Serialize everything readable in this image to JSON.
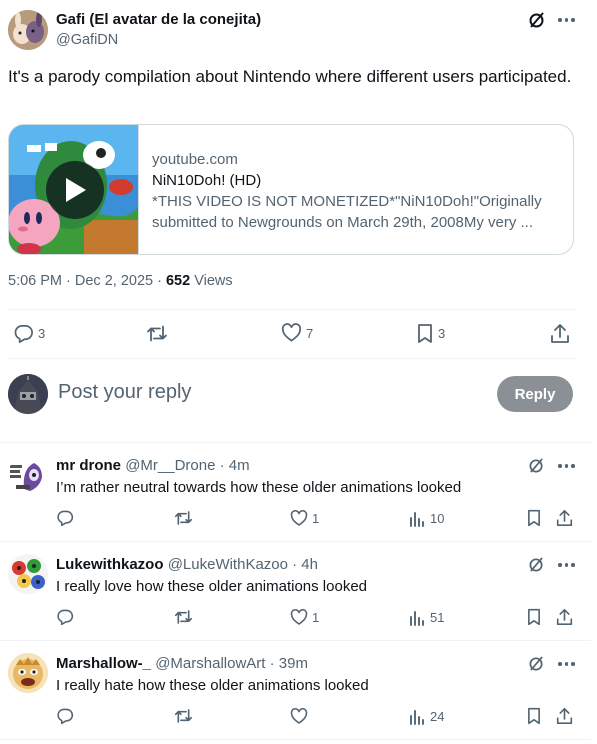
{
  "tweet": {
    "author_name": "Gafi (El avatar de la conejita)",
    "author_handle": "@GafiDN",
    "text": "It's a parody compilation about Nintendo where different users participated.",
    "card": {
      "domain": "youtube.com",
      "title": "NiN10Doh! (HD)",
      "description": "*THIS VIDEO IS NOT MONETIZED*\"NiN10Doh!\"Originally submitted to Newgrounds on March 29th, 2008My very ..."
    },
    "time": "5:06 PM · Dec 2, 2025 · ",
    "views_count": "652",
    "views_label": " Views",
    "stats": {
      "replies": "3",
      "retweets": "",
      "likes": "7",
      "bookmarks": "3"
    }
  },
  "reply_box": {
    "placeholder": "Post your reply",
    "button_label": "Reply"
  },
  "replies": [
    {
      "name": "mr drone",
      "handle": "@Mr__Drone · 4m",
      "text": "I’m rather neutral towards how these older animations looked",
      "likes": "1",
      "views": "10"
    },
    {
      "name": "Lukewithkazoo",
      "handle": "@LukeWithKazoo · 4h",
      "text": "I really love how these older animations looked",
      "likes": "1",
      "views": "51"
    },
    {
      "name": "Marshallow-_",
      "handle": "@MarshallowArt · 39m",
      "text": "I really hate how these older animations looked",
      "likes": "",
      "views": "24"
    }
  ],
  "icons": {
    "grok": "grok-icon",
    "more": "more-icon",
    "reply": "reply-icon",
    "retweet": "retweet-icon",
    "like": "heart-icon",
    "bookmark": "bookmark-icon",
    "share": "share-icon",
    "views": "views-icon",
    "play": "play-icon"
  },
  "colors": {
    "text": "#0f1419",
    "secondary": "#536471",
    "border": "#cfd9de",
    "reply_button": "#8b9096"
  }
}
